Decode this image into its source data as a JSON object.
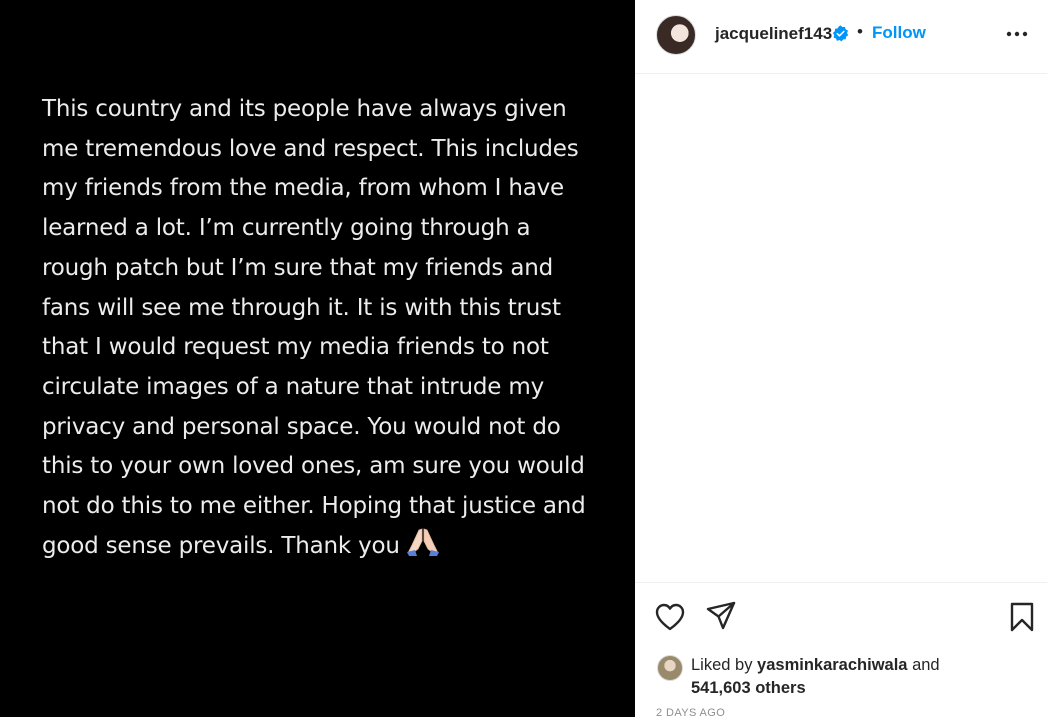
{
  "post": {
    "body_text": "This country and its people have always given\nme tremendous love and respect. This includes\nmy friends from the media, from whom I have\nlearned a lot. I’m currently going through a\nrough patch but I’m sure that my friends and\nfans will see me through it. It is with this trust\nthat I would request my media friends to not\ncirculate images of a nature that intrude my\nprivacy and personal space. You would not do\nthis to your own loved ones, am sure you would\nnot do this to me either. Hoping that justice and\ngood sense prevails. Thank you",
    "emoji": "folded-hands-emoji"
  },
  "header": {
    "username": "jacquelinef143",
    "verified_icon": "verified-badge-icon",
    "separator": "•",
    "follow_label": "Follow",
    "more_icon": "more-options-icon",
    "verified_color": "#0095f6",
    "follow_color": "#0095f6"
  },
  "actions": {
    "like_icon": "heart-icon",
    "share_icon": "paper-plane-icon",
    "save_icon": "bookmark-icon"
  },
  "likes": {
    "prefix": "Liked by ",
    "user": "yasminkarachiwala",
    "conjunction": " and",
    "others": "541,603 others"
  },
  "timestamp": "2 DAYS AGO"
}
